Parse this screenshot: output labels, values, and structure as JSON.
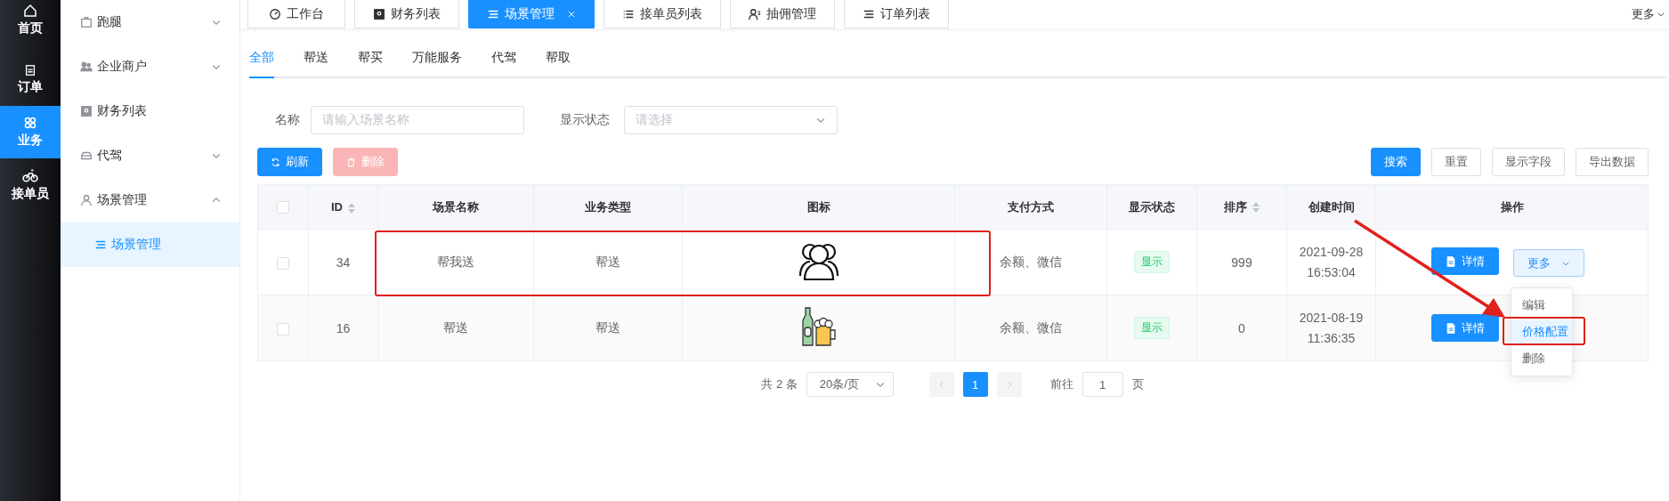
{
  "nav": [
    {
      "label": "首页",
      "selected": false
    },
    {
      "label": "订单",
      "selected": false
    },
    {
      "label": "业务",
      "selected": true
    },
    {
      "label": "接单员",
      "selected": false
    }
  ],
  "sidebar": {
    "items": [
      {
        "label": "跑腿",
        "expanded": false,
        "has_children": true
      },
      {
        "label": "企业商户",
        "expanded": false,
        "has_children": true
      },
      {
        "label": "财务列表",
        "has_children": false
      },
      {
        "label": "代驾",
        "expanded": false,
        "has_children": true
      },
      {
        "label": "场景管理",
        "expanded": true,
        "has_children": true,
        "children": [
          {
            "label": "场景管理",
            "selected": true
          }
        ]
      }
    ]
  },
  "page_tabs": [
    {
      "label": "工作台",
      "selected": false,
      "closable": false
    },
    {
      "label": "财务列表",
      "selected": false,
      "closable": false
    },
    {
      "label": "场景管理",
      "selected": true,
      "closable": true
    },
    {
      "label": "接单员列表",
      "selected": false,
      "closable": false
    },
    {
      "label": "抽佣管理",
      "selected": false,
      "closable": false
    },
    {
      "label": "订单列表",
      "selected": false,
      "closable": false
    }
  ],
  "more_tabs": "更多",
  "category_tabs": [
    {
      "label": "全部",
      "selected": true
    },
    {
      "label": "帮送",
      "selected": false
    },
    {
      "label": "帮买",
      "selected": false
    },
    {
      "label": "万能服务",
      "selected": false
    },
    {
      "label": "代驾",
      "selected": false
    },
    {
      "label": "帮取",
      "selected": false
    }
  ],
  "filters": [
    {
      "label": "名称",
      "kind": "input",
      "placeholder": "请输入场景名称"
    },
    {
      "label": "显示状态",
      "kind": "select",
      "placeholder": "请选择"
    }
  ],
  "left_buttons": [
    {
      "label": "刷新",
      "disabled": false
    },
    {
      "label": "删除",
      "disabled": true
    }
  ],
  "right_buttons": [
    {
      "label": "搜索",
      "primary": true
    },
    {
      "label": "重置",
      "primary": false
    },
    {
      "label": "显示字段",
      "primary": false
    },
    {
      "label": "导出数据",
      "primary": false
    }
  ],
  "table": {
    "header_checked": false,
    "columns": [
      {
        "label": "ID",
        "sortable": true
      },
      {
        "label": "场景名称"
      },
      {
        "label": "业务类型"
      },
      {
        "label": "图标"
      },
      {
        "label": "支付方式"
      },
      {
        "label": "显示状态"
      },
      {
        "label": "排序",
        "sortable": true
      },
      {
        "label": "创建时间"
      },
      {
        "label": "操作"
      }
    ],
    "rows": [
      {
        "checked": false,
        "id": "34",
        "name": "帮我送",
        "type": "帮送",
        "icon": {
          "kind": "people"
        },
        "payment": "余额、微信",
        "status": "显示",
        "sort": "999",
        "created": [
          "2021-09-28",
          "16:53:04"
        ],
        "actions": [
          {
            "kind": "detail",
            "label": "详情"
          },
          {
            "kind": "more",
            "label": "更多"
          }
        ]
      },
      {
        "checked": false,
        "id": "16",
        "name": "帮送",
        "type": "帮送",
        "icon": {
          "kind": "beer"
        },
        "payment": "余额、微信",
        "status": "显示",
        "sort": "0",
        "created": [
          "2021-08-19",
          "11:36:35"
        ],
        "actions": [
          {
            "kind": "detail",
            "label": "详情"
          }
        ]
      }
    ]
  },
  "dropdown": {
    "items": [
      {
        "label": "编辑",
        "selected": false
      },
      {
        "label": "价格配置",
        "selected": true
      },
      {
        "label": "删除",
        "selected": false
      }
    ]
  },
  "pagination": {
    "total": "共 2 条",
    "page_size": "20条/页",
    "pages": [
      {
        "label": "1",
        "selected": true
      }
    ],
    "goto_label": "前往",
    "goto_value": "1",
    "goto_suffix": "页"
  }
}
